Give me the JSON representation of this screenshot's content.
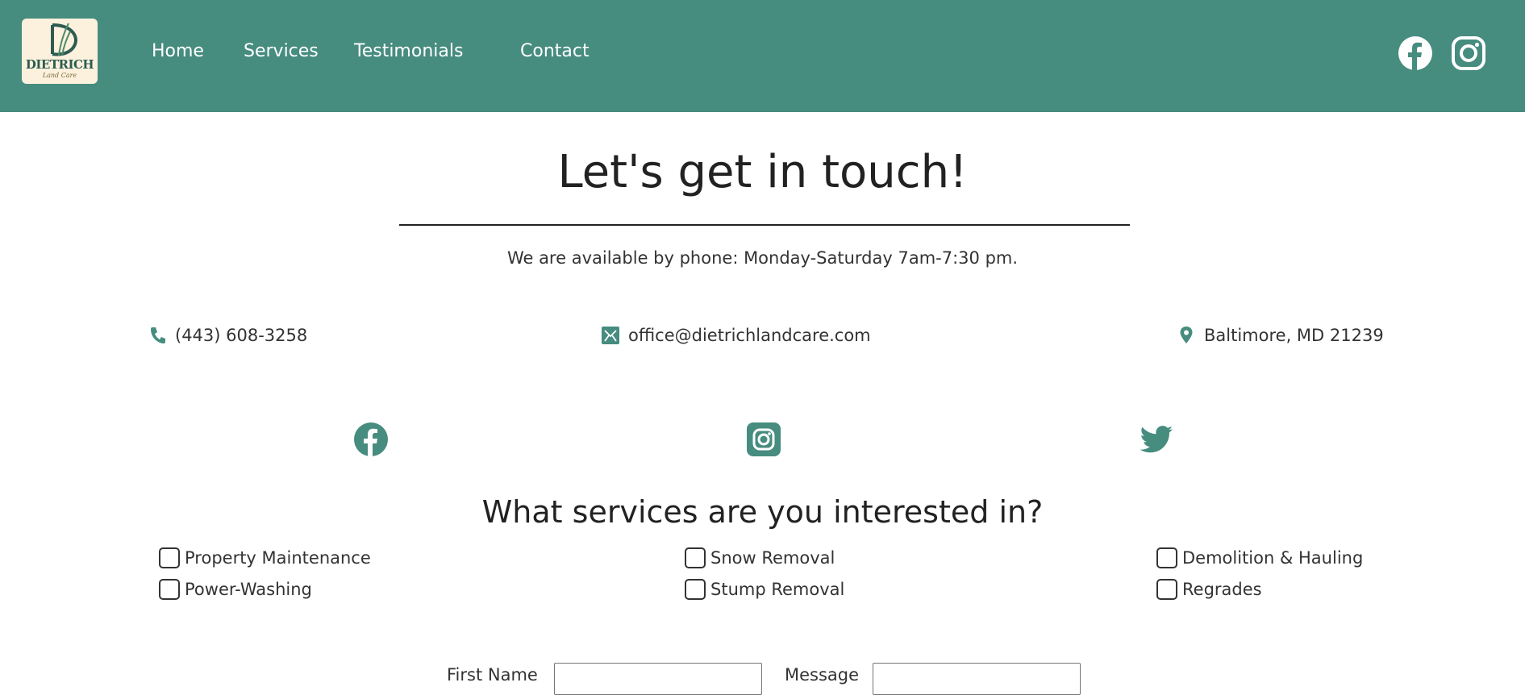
{
  "brand": {
    "logo_name": "DIETRICH",
    "logo_sub": "Land Care",
    "accent_color": "#468c7f"
  },
  "nav": {
    "items": [
      {
        "label": "Home"
      },
      {
        "label": "Services"
      },
      {
        "label": "Testimonials"
      },
      {
        "label": "Contact"
      }
    ]
  },
  "header_social": {
    "icons": [
      "facebook-icon",
      "instagram-icon"
    ]
  },
  "hero": {
    "title": "Let's get in touch!",
    "availability": "We are available by phone: Monday-Saturday 7am-7:30 pm."
  },
  "contact": {
    "phone": "(443) 608-3258",
    "email": "office@dietrichlandcare.com",
    "location": "Baltimore, MD 21239"
  },
  "social_links": {
    "icons": [
      "facebook-icon",
      "instagram-icon",
      "twitter-icon"
    ]
  },
  "services": {
    "title": "What services are you interested in?",
    "options": [
      {
        "label": "Property Maintenance",
        "checked": false
      },
      {
        "label": "Power-Washing",
        "checked": false
      },
      {
        "label": "Snow Removal",
        "checked": false
      },
      {
        "label": "Stump Removal",
        "checked": false
      },
      {
        "label": "Demolition & Hauling",
        "checked": false
      },
      {
        "label": "Regrades",
        "checked": false
      }
    ]
  },
  "form": {
    "first_name_label": "First Name",
    "first_name_value": "",
    "message_label": "Message",
    "message_value": ""
  }
}
